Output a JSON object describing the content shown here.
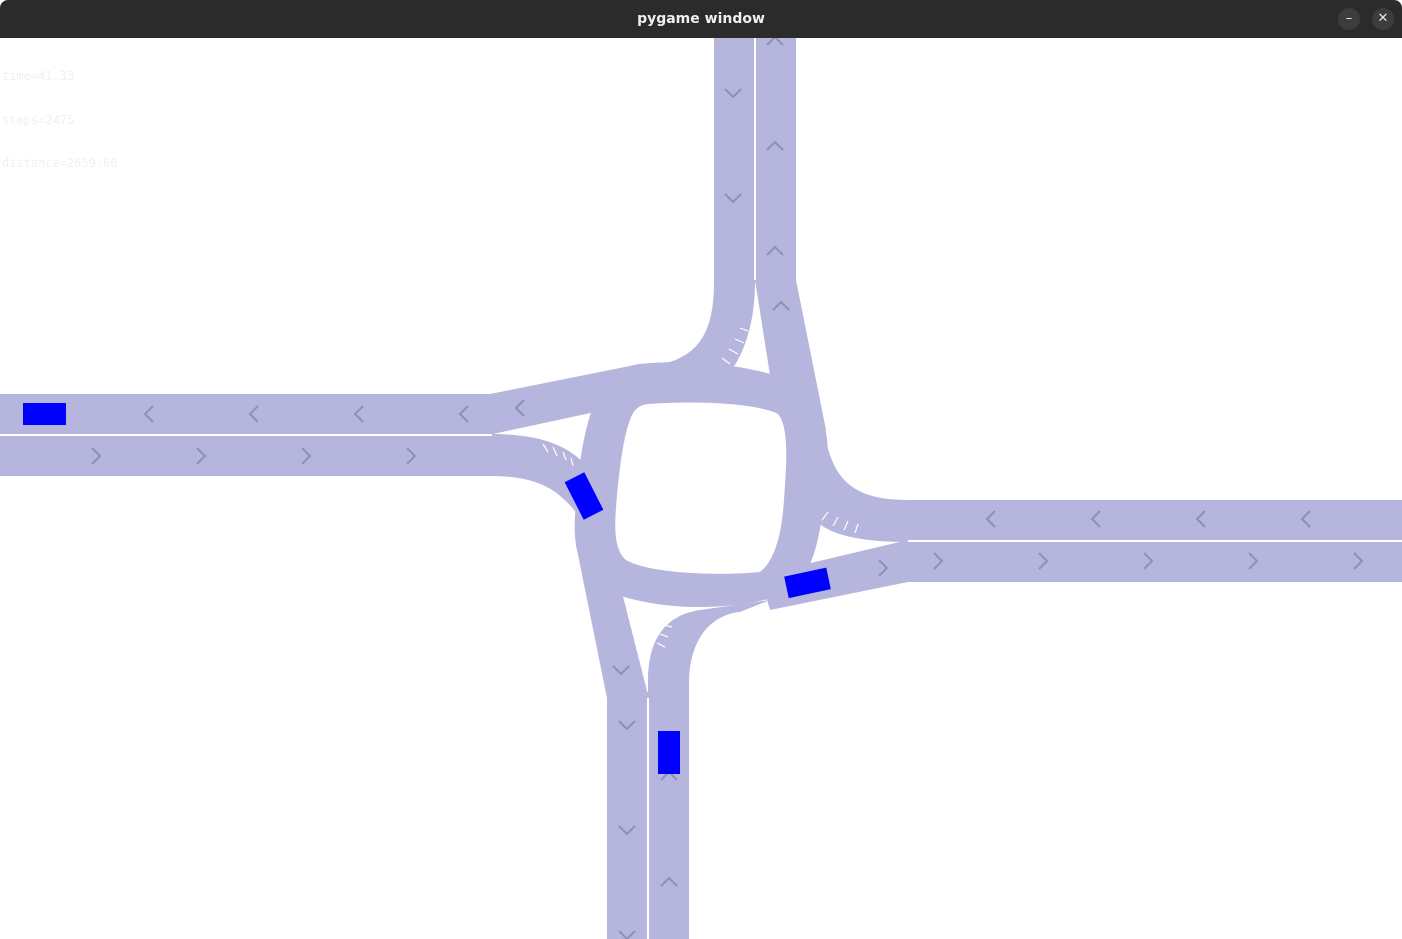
{
  "window": {
    "title": "pygame window",
    "minimize_icon": "minimize-icon",
    "close_icon": "close-icon",
    "minimize_glyph": "–",
    "close_glyph": "✕"
  },
  "hud": {
    "time": "time=41.33",
    "steps": "steps=2475",
    "distance": "distance=2659.60"
  },
  "colors": {
    "background": "#ffffff",
    "road": "#b5b5dd",
    "lane_divider": "#ffffff",
    "arrow": "#8f8fbc",
    "vehicle": "#0000ff",
    "titlebar": "#2b2b2b"
  },
  "scene": {
    "type": "roundabout-intersection",
    "approach_roads": [
      "north",
      "south",
      "east",
      "west"
    ],
    "vehicle_count": 4,
    "lane_arrow_icon": "chevron-icon"
  }
}
